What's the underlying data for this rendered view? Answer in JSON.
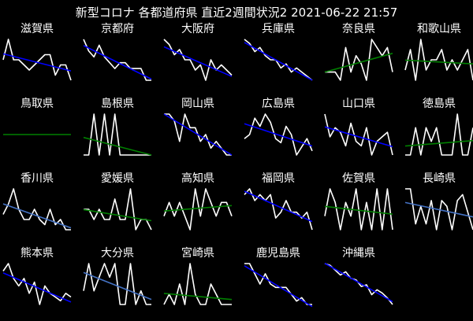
{
  "title": "新型コロナ 各都道府県 直近2週間状況2  2021-06-22 21:57",
  "colors": {
    "line": "#ffffff",
    "trend_down": "#0000ff",
    "trend_down_light": "#4472c4",
    "trend_flat": "#008000"
  },
  "chart_data": [
    {
      "type": "line",
      "title": "滋賀県",
      "values": [
        5,
        9,
        5,
        5,
        4,
        3,
        4,
        5,
        6,
        6,
        2,
        4,
        4,
        1
      ],
      "trend": "down"
    },
    {
      "type": "line",
      "title": "京都府",
      "values": [
        8,
        6,
        5,
        7,
        5,
        4,
        3,
        4,
        4,
        3,
        3,
        3,
        1,
        1
      ],
      "trend": "down"
    },
    {
      "type": "line",
      "title": "大阪府",
      "values": [
        9,
        8,
        6,
        7,
        5,
        5,
        3,
        4,
        1,
        5,
        3,
        4,
        3,
        2
      ],
      "trend": "down"
    },
    {
      "type": "line",
      "title": "兵庫県",
      "values": [
        10,
        9,
        7,
        8,
        6,
        5,
        5,
        3,
        4,
        2,
        3,
        2,
        1,
        0
      ],
      "trend": "down"
    },
    {
      "type": "line",
      "title": "奈良県",
      "values": [
        1,
        1,
        1,
        0,
        4,
        1,
        3,
        2,
        0,
        5,
        4,
        3,
        4,
        1
      ],
      "trend": "flat"
    },
    {
      "type": "line",
      "title": "和歌山県",
      "values": [
        1,
        3,
        0,
        4,
        1,
        2,
        2,
        3,
        1,
        2,
        1,
        2,
        3,
        0
      ],
      "trend": "flat"
    },
    {
      "type": "line",
      "title": "鳥取県",
      "values": [
        0,
        0,
        0,
        0,
        0,
        0,
        0,
        0,
        0,
        0,
        0,
        0,
        0,
        0
      ],
      "trend": "flat"
    },
    {
      "type": "line",
      "title": "島根県",
      "values": [
        0,
        0,
        1,
        0,
        1,
        0,
        1,
        0,
        0,
        0,
        0,
        0,
        0,
        0
      ],
      "trend": "flat"
    },
    {
      "type": "line",
      "title": "岡山県",
      "values": [
        8,
        8,
        7,
        4,
        8,
        6,
        6,
        4,
        5,
        3,
        4,
        3,
        2,
        2
      ],
      "trend": "down"
    },
    {
      "type": "line",
      "title": "広島県",
      "values": [
        8,
        9,
        13,
        11,
        14,
        12,
        8,
        7,
        11,
        9,
        4,
        6,
        8,
        5
      ],
      "trend": "down"
    },
    {
      "type": "line",
      "title": "山口県",
      "values": [
        9,
        4,
        6,
        5,
        2,
        7,
        3,
        2,
        6,
        0,
        3,
        4,
        5,
        0
      ],
      "trend": "down"
    },
    {
      "type": "line",
      "title": "徳島県",
      "values": [
        0,
        0,
        2,
        0,
        2,
        1,
        2,
        0,
        0,
        0,
        3,
        0,
        0,
        2
      ],
      "trend": "flat"
    },
    {
      "type": "line",
      "title": "香川県",
      "values": [
        3,
        5,
        8,
        4,
        2,
        2,
        4,
        2,
        1,
        4,
        1,
        2,
        0,
        0
      ],
      "trend": "down"
    },
    {
      "type": "line",
      "title": "愛媛県",
      "values": [
        2,
        2,
        1,
        2,
        1,
        1,
        3,
        1,
        1,
        4,
        0,
        1,
        1,
        0
      ],
      "trend": "flat"
    },
    {
      "type": "line",
      "title": "高知県",
      "values": [
        1,
        2,
        1,
        2,
        1,
        0,
        3,
        1,
        3,
        2,
        1,
        2,
        2,
        1
      ],
      "trend": "flat"
    },
    {
      "type": "line",
      "title": "福岡県",
      "values": [
        8,
        9,
        7,
        8,
        7,
        8,
        4,
        5,
        7,
        5,
        5,
        4,
        5,
        2
      ],
      "trend": "down"
    },
    {
      "type": "line",
      "title": "佐賀県",
      "values": [
        1,
        3,
        2,
        0,
        2,
        1,
        3,
        0,
        2,
        0,
        3,
        0,
        3,
        0
      ],
      "trend": "flat"
    },
    {
      "type": "line",
      "title": "長崎県",
      "values": [
        8,
        8,
        2,
        5,
        2,
        6,
        1,
        6,
        5,
        1,
        6,
        7,
        4,
        1
      ],
      "trend": "down"
    },
    {
      "type": "line",
      "title": "熊本県",
      "values": [
        10,
        12,
        8,
        6,
        8,
        4,
        7,
        1,
        6,
        4,
        3,
        2,
        4,
        3
      ],
      "trend": "down"
    },
    {
      "type": "line",
      "title": "大分県",
      "values": [
        2,
        4,
        2,
        3,
        4,
        3,
        4,
        1,
        1,
        4,
        1,
        2,
        1,
        1
      ],
      "trend": "down"
    },
    {
      "type": "line",
      "title": "宮崎県",
      "values": [
        0,
        1,
        0,
        2,
        0,
        4,
        1,
        0,
        0,
        2,
        1,
        0,
        0,
        0
      ],
      "trend": "flat"
    },
    {
      "type": "line",
      "title": "鹿児島県",
      "values": [
        14,
        14,
        11,
        8,
        11,
        8,
        7,
        7,
        7,
        5,
        3,
        4,
        2,
        2
      ],
      "trend": "down"
    },
    {
      "type": "line",
      "title": "沖縄県",
      "values": [
        30,
        29,
        26,
        23,
        25,
        21,
        20,
        16,
        17,
        11,
        14,
        12,
        9,
        5
      ],
      "trend": "down"
    }
  ]
}
